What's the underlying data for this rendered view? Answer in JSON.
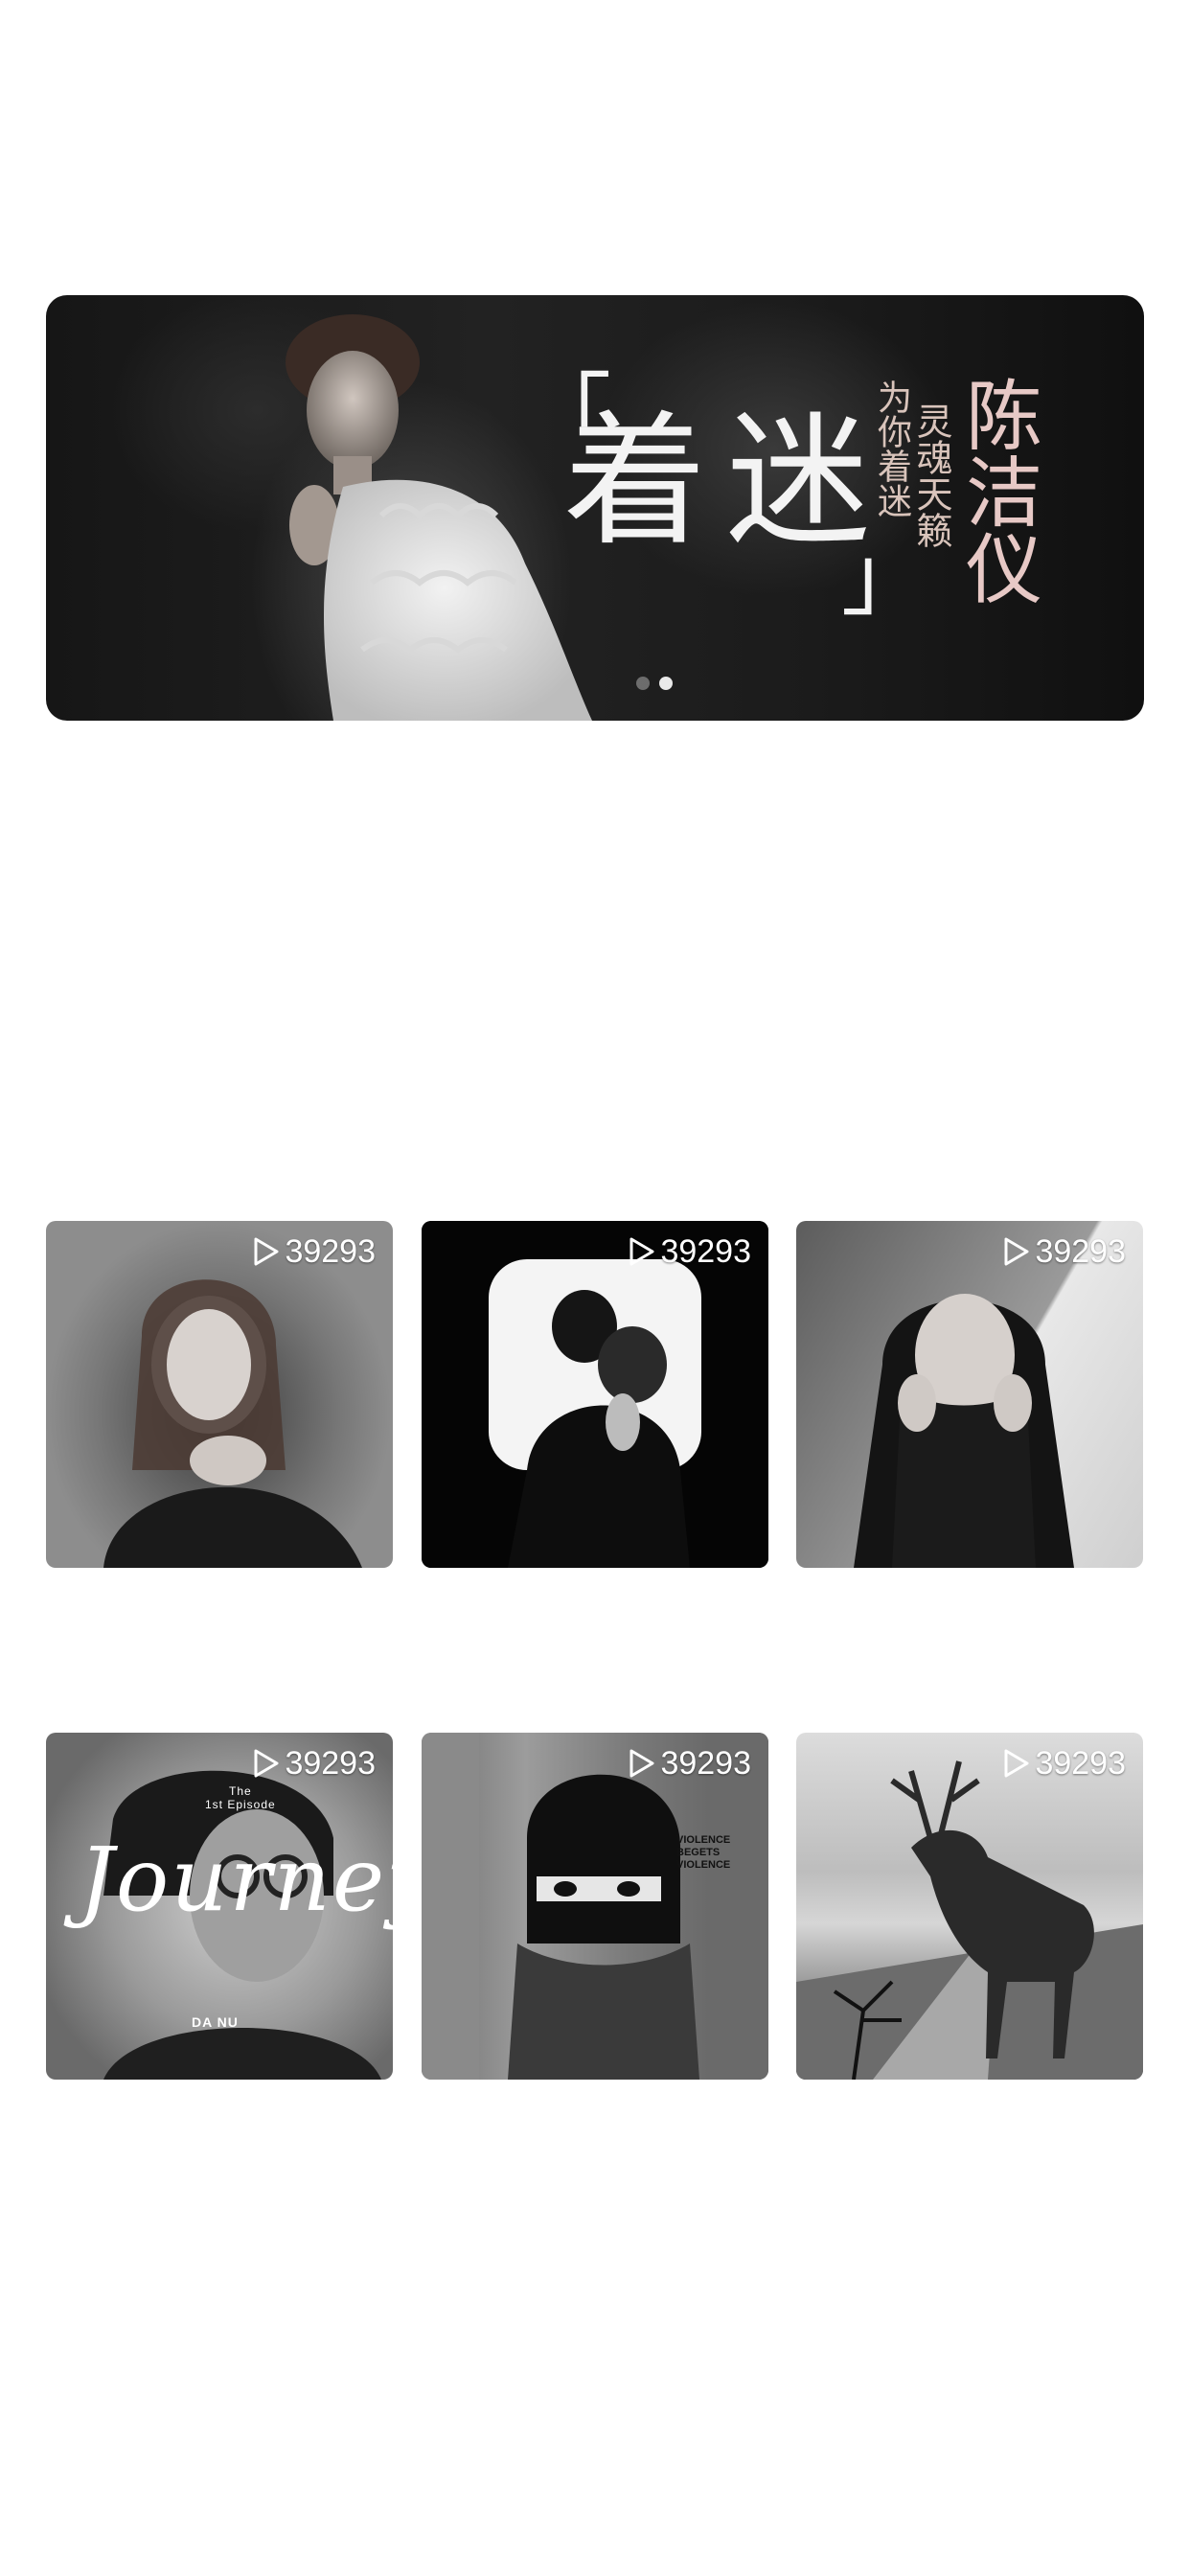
{
  "banner": {
    "main_title": "着迷",
    "bracket_open": "「",
    "bracket_close": "」",
    "subtitle": "为你着迷",
    "tagline": "灵魂天籁",
    "artist": "陈洁仪",
    "dots": 2,
    "active_dot": 1
  },
  "playlists": [
    {
      "plays": "39293"
    },
    {
      "plays": "39293"
    },
    {
      "plays": "39293"
    },
    {
      "plays": "39293",
      "cover_title": "Journey",
      "cover_top": "The",
      "cover_episode": "1st Episode",
      "cover_artist": "DA NU"
    },
    {
      "plays": "39293",
      "cover_lines": [
        "VIOLENCE",
        "BEGETS",
        "VIOLENCE"
      ]
    },
    {
      "plays": "39293"
    }
  ],
  "icons": {
    "play": "play-icon"
  },
  "colors": {
    "background": "#ffffff",
    "banner_title": "#f3f3f3",
    "banner_accent": "#d9c4bb",
    "artist_accent": "#e7c9c6"
  }
}
